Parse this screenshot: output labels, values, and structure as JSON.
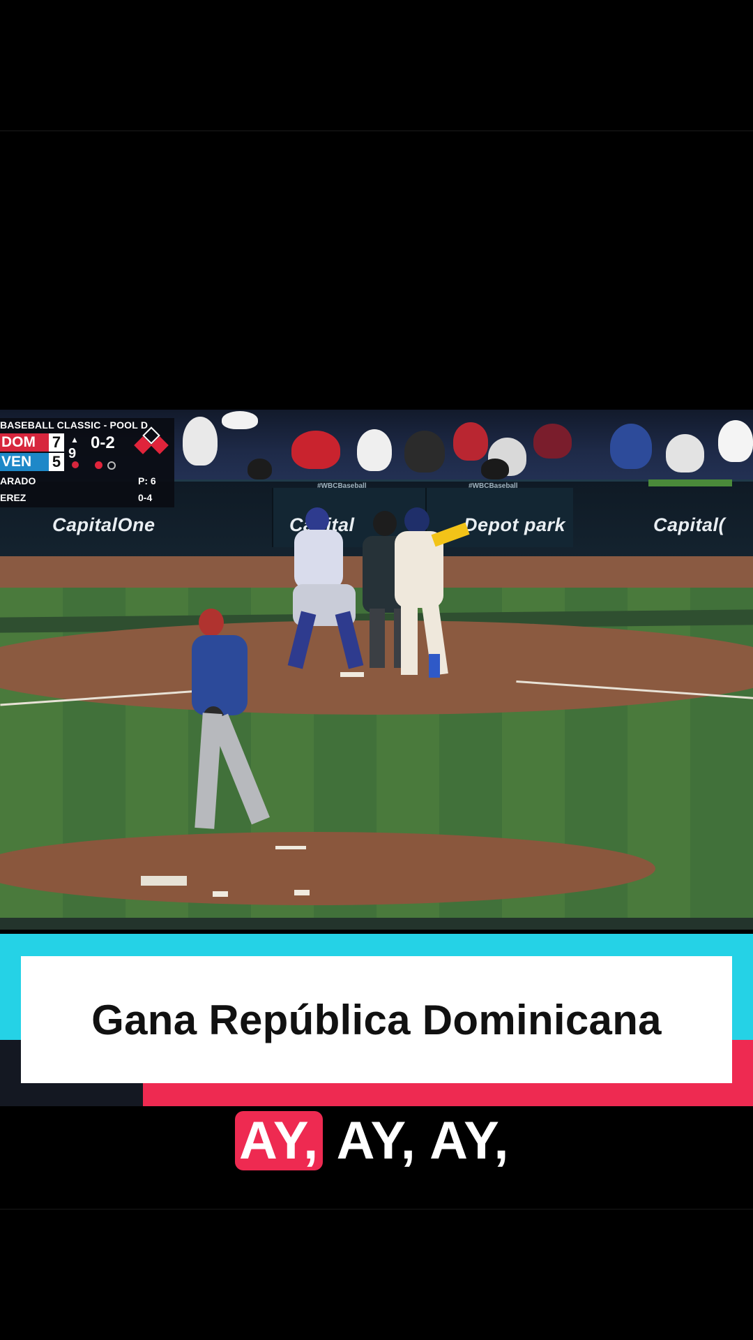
{
  "scorebug": {
    "header": "BASEBALL CLASSIC - POOL D",
    "team1": {
      "abbr": "DOM",
      "score": "7",
      "color": "#d7263d"
    },
    "team2": {
      "abbr": "VEN",
      "score": "5",
      "color": "#1e88c8"
    },
    "inning": "9",
    "count": "0-2",
    "pitcher": "ARADO",
    "pitch_count": "P: 6",
    "batter": "EREZ",
    "batter_line": "0-4"
  },
  "stadium": {
    "ad_left": "CapitalOne",
    "ad_center_left": "Capital",
    "ad_center_right": "Depot park",
    "ad_right": "Capital(",
    "hashtag": "#WBCBaseball"
  },
  "caption": {
    "title": "Gana República Dominicana",
    "lyric_highlight": "AY,",
    "lyric_rest": " AY, AY,"
  },
  "colors": {
    "cyan": "#25d2e6",
    "red": "#ee2a51",
    "card": "#ffffff"
  }
}
